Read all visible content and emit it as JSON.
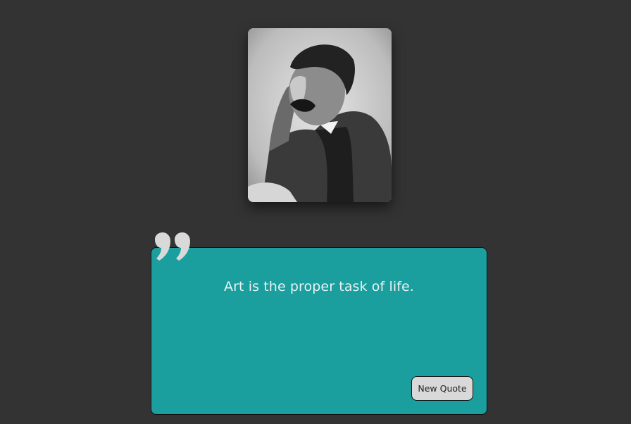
{
  "quote": {
    "text": "Art is the proper task of life.",
    "button_label": "New Quote"
  },
  "icons": {
    "quote_mark": "closing-quote-icon"
  },
  "colors": {
    "background": "#333333",
    "card": "#1a9e9e",
    "quote_text": "#e8f3f3",
    "quote_mark": "#d9d9d9",
    "button_bg": "#d9d9d9"
  }
}
